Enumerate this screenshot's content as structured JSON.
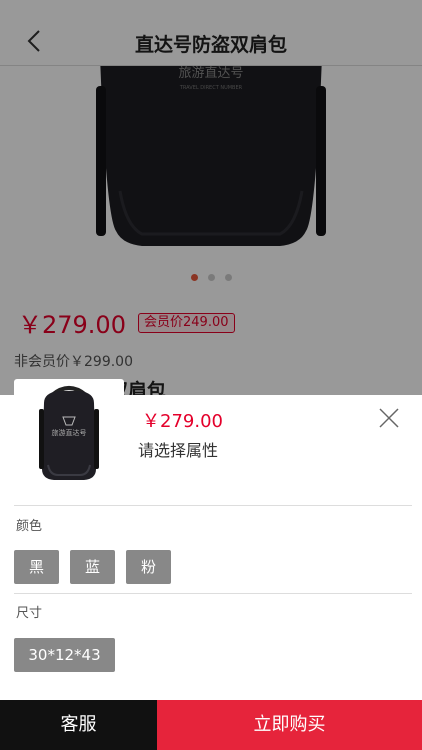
{
  "nav": {
    "title": "直达号防盗双肩包",
    "back_icon": "chevron-left-icon"
  },
  "product": {
    "image_logo_cn": "旅游直达号",
    "image_logo_en": "TRAVEL DIRECT NUMBER",
    "price": "￥279.00",
    "member_price": "会员价249.00",
    "nonmember_price": "非会员价￥299.00",
    "title_fragment": "双肩包",
    "carousel": {
      "count": 3,
      "active_index": 0
    }
  },
  "sheet": {
    "price": "￥279.00",
    "hint": "请选择属性",
    "thumb_logo": "旅游直达号",
    "close_icon": "close-icon",
    "color_label": "颜色",
    "color_options": [
      "黑",
      "蓝",
      "粉"
    ],
    "size_label": "尺寸",
    "size_options": [
      "30*12*43"
    ]
  },
  "bottom": {
    "service_label": "客服",
    "buy_label": "立即购买"
  },
  "colors": {
    "accent": "#e4002b",
    "buy_button": "#e6243b",
    "service_button": "#111111",
    "option_bg": "#888888"
  }
}
